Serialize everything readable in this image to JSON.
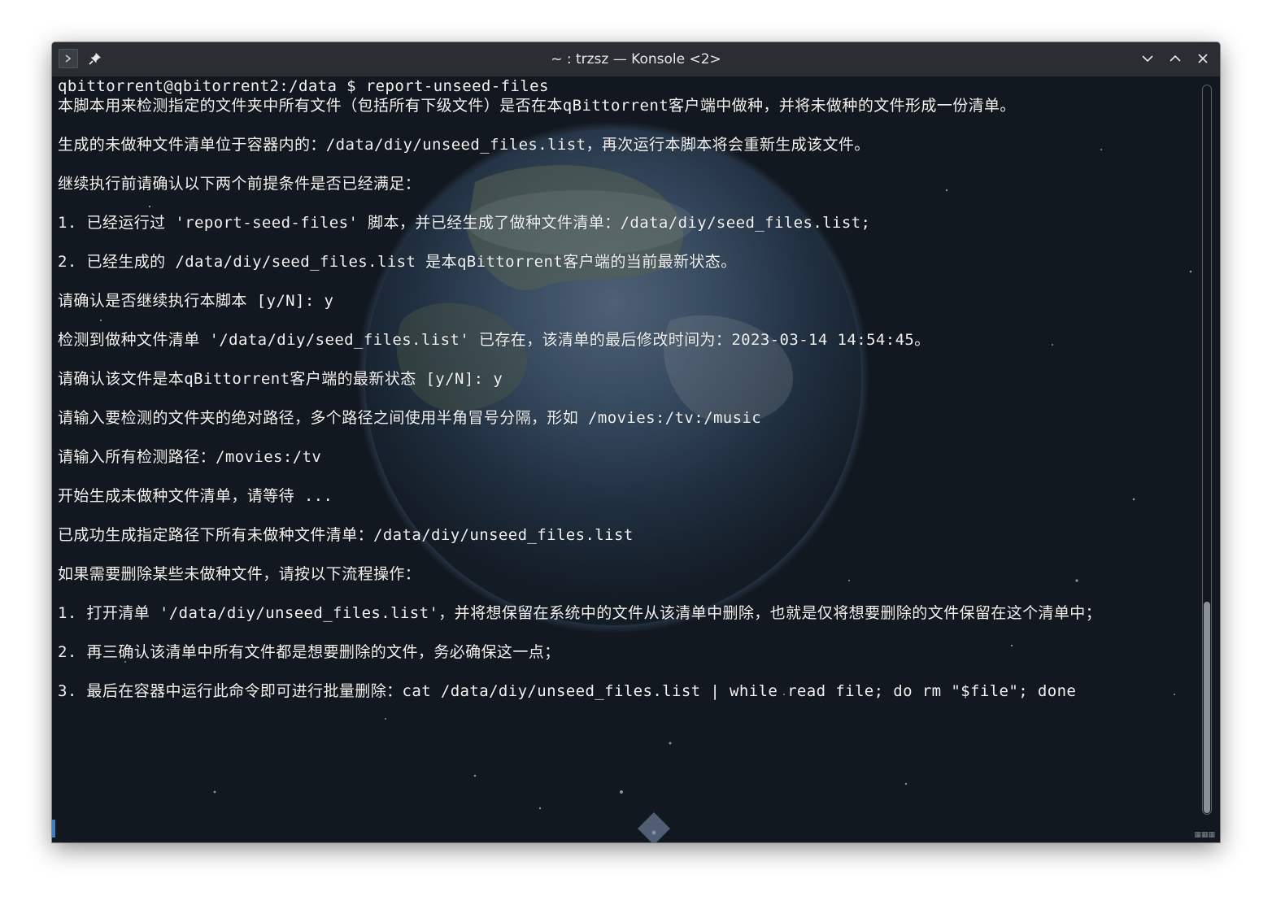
{
  "window": {
    "title": "~ : trzsz — Konsole <2>"
  },
  "icons": {
    "app": "konsole-app-icon",
    "pin": "pin-icon",
    "minimize": "chevron-down-icon",
    "maximize": "chevron-up-icon",
    "close": "close-icon"
  },
  "terminal": {
    "lines": [
      "qbittorrent@qbitorrent2:/data $ report-unseed-files",
      "本脚本用来检测指定的文件夹中所有文件（包括所有下级文件）是否在本qBittorrent客户端中做种，并将未做种的文件形成一份清单。",
      "",
      "生成的未做种文件清单位于容器内的：/data/diy/unseed_files.list，再次运行本脚本将会重新生成该文件。",
      "",
      "继续执行前请确认以下两个前提条件是否已经满足：",
      "",
      "1. 已经运行过 'report-seed-files' 脚本，并已经生成了做种文件清单：/data/diy/seed_files.list;",
      "",
      "2. 已经生成的 /data/diy/seed_files.list 是本qBittorrent客户端的当前最新状态。",
      "",
      "请确认是否继续执行本脚本 [y/N]: y",
      "",
      "检测到做种文件清单 '/data/diy/seed_files.list' 已存在，该清单的最后修改时间为：2023-03-14 14:54:45。",
      "",
      "请确认该文件是本qBittorrent客户端的最新状态 [y/N]: y",
      "",
      "请输入要检测的文件夹的绝对路径，多个路径之间使用半角冒号分隔，形如 /movies:/tv:/music",
      "",
      "请输入所有检测路径：/movies:/tv",
      "",
      "开始生成未做种文件清单，请等待 ...",
      "",
      "已成功生成指定路径下所有未做种文件清单：/data/diy/unseed_files.list",
      "",
      "如果需要删除某些未做种文件，请按以下流程操作：",
      "",
      "1. 打开清单 '/data/diy/unseed_files.list'，并将想保留在系统中的文件从该清单中删除，也就是仅将想要删除的文件保留在这个清单中；",
      "",
      "2. 再三确认该清单中所有文件都是想要删除的文件，务必确保这一点；",
      "",
      "3. 最后在容器中运行此命令即可进行批量删除：cat /data/diy/unseed_files.list | while read file; do rm \"$file\"; done"
    ]
  },
  "colors": {
    "titlebar": "#2a2e32",
    "terminal_text": "#f2f2f2",
    "accent": "#3d7fc1"
  }
}
